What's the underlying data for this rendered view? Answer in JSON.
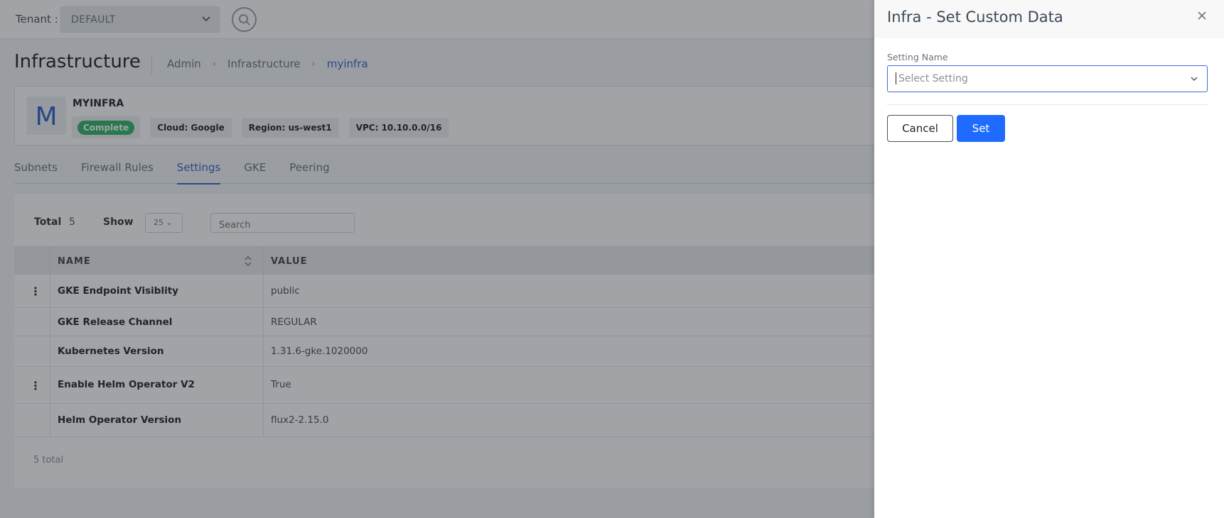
{
  "topbar": {
    "tenant_label": "Tenant :",
    "tenant_value": "DEFAULT"
  },
  "page": {
    "title": "Infrastructure",
    "breadcrumb": [
      "Admin",
      "Infrastructure",
      "myinfra"
    ]
  },
  "infra": {
    "avatar_letter": "M",
    "name": "MYINFRA",
    "status": "Complete",
    "chips": [
      "Cloud: Google",
      "Region: us-west1",
      "VPC: 10.10.0.0/16"
    ]
  },
  "tabs": [
    {
      "label": "Subnets",
      "active": false
    },
    {
      "label": "Firewall Rules",
      "active": false
    },
    {
      "label": "Settings",
      "active": true
    },
    {
      "label": "GKE",
      "active": false
    },
    {
      "label": "Peering",
      "active": false
    }
  ],
  "table": {
    "total_label": "Total",
    "total_value": "5",
    "show_label": "Show",
    "page_size": "25",
    "search_placeholder": "Search",
    "columns": [
      "NAME",
      "VALUE"
    ],
    "rows": [
      {
        "name": "GKE Endpoint Visiblity",
        "value": "public",
        "has_menu": true
      },
      {
        "name": "GKE Release Channel",
        "value": "REGULAR",
        "has_menu": false
      },
      {
        "name": "Kubernetes Version",
        "value": "1.31.6-gke.1020000",
        "has_menu": false
      },
      {
        "name": "Enable Helm Operator V2",
        "value": "True",
        "has_menu": true
      },
      {
        "name": "Helm Operator Version",
        "value": "flux2-2.15.0",
        "has_menu": false
      }
    ],
    "footer": "5 total"
  },
  "drawer": {
    "title": "Infra - Set Custom Data",
    "field_label": "Setting Name",
    "field_placeholder": "Select Setting",
    "cancel_label": "Cancel",
    "set_label": "Set"
  },
  "colors": {
    "primary": "#1f6bff",
    "link": "#3366cc",
    "status_complete": "#2db564"
  }
}
